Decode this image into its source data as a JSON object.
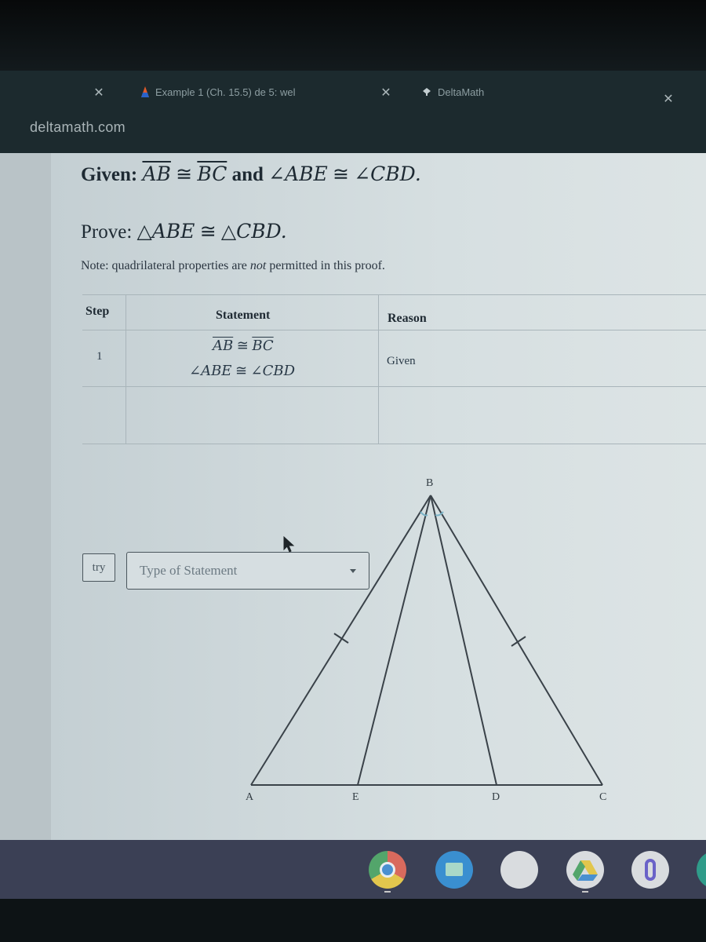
{
  "browser": {
    "tabs": [
      {
        "label": "Example 1 (Ch. 15.5) de 5: wel",
        "favicon": "gdoc-icon",
        "close_icon": "close-icon"
      },
      {
        "label": "DeltaMath",
        "favicon": "deltamath-icon",
        "close_icon": "close-icon"
      }
    ],
    "close_icon": "close-icon",
    "url": "deltamath.com"
  },
  "problem": {
    "given_label": "Given:",
    "given_seg1": "AB",
    "given_seg2": "BC",
    "given_and": "and",
    "given_angle1": "∠ABE",
    "given_angle2": "∠CBD.",
    "congruent": "≅",
    "prove_label": "Prove:",
    "prove_tri1": "△ABE",
    "prove_tri2": "△CBD.",
    "note_prefix": "Note: quadrilateral properties are ",
    "note_em": "not",
    "note_suffix": " permitted in this proof."
  },
  "proof_table": {
    "headers": {
      "step": "Step",
      "statement": "Statement",
      "reason": "Reason"
    },
    "rows": [
      {
        "step": "1",
        "statement_line1_a": "AB",
        "statement_line1_b": "BC",
        "statement_line2_a": "∠ABE",
        "statement_line2_b": "∠CBD",
        "congruent": "≅",
        "reason": "Given"
      }
    ],
    "try_button": "try",
    "statement_select": {
      "placeholder": "Type of Statement",
      "icon": "caret-down-icon"
    }
  },
  "diagram": {
    "points": {
      "A": "A",
      "B": "B",
      "C": "C",
      "D": "D",
      "E": "E"
    },
    "segments": [
      "AB",
      "BC",
      "AC",
      "BE",
      "BD"
    ],
    "tick_marks": [
      "AB",
      "BC"
    ],
    "angle_marks": [
      "ABE",
      "CBD"
    ]
  },
  "shelf": {
    "apps": [
      {
        "name": "chrome-icon"
      },
      {
        "name": "files-icon"
      },
      {
        "name": "app-icon"
      },
      {
        "name": "drive-icon"
      },
      {
        "name": "app-0-icon"
      },
      {
        "name": "app-partial-icon"
      }
    ]
  }
}
